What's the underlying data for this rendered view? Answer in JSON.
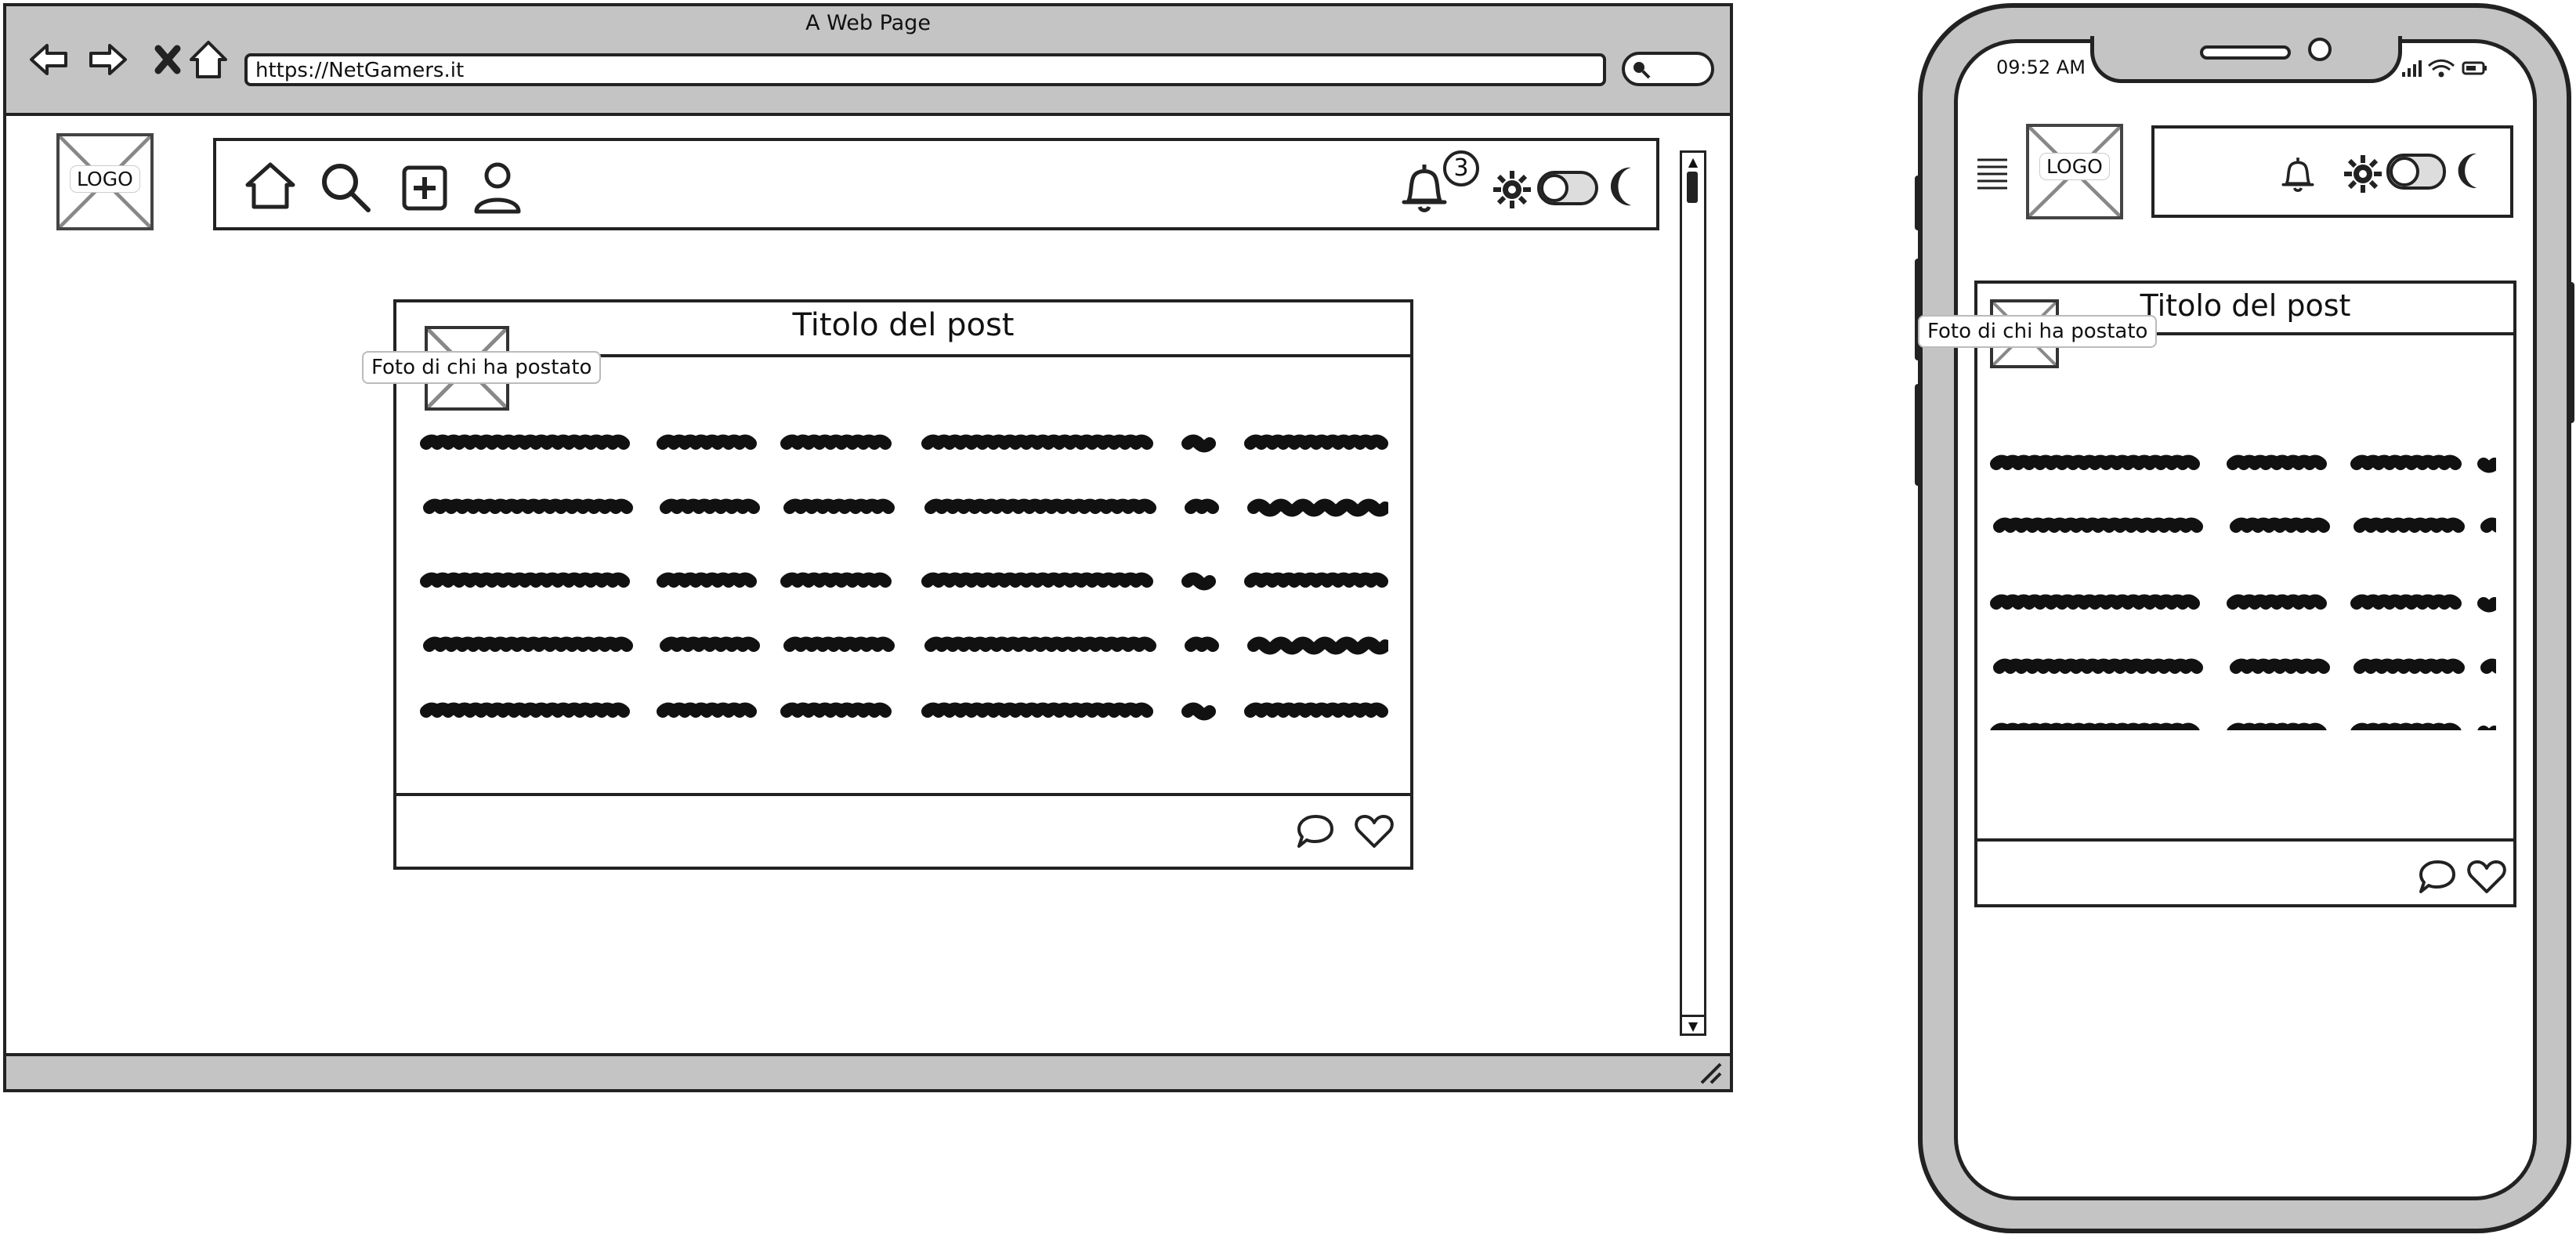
{
  "browser": {
    "window_title": "A Web Page",
    "url": "https://NetGamers.it",
    "nav_icons": [
      "back-arrow-icon",
      "forward-arrow-icon",
      "close-x-icon",
      "home-icon"
    ]
  },
  "desktop": {
    "logo": "LOGO",
    "navbar": {
      "left_icons": [
        "home-icon",
        "search-icon",
        "plus-square-icon",
        "user-icon"
      ],
      "right_icons": [
        "bell-icon",
        "sun-icon",
        "toggle-switch",
        "moon-icon"
      ],
      "notification_count": "3"
    },
    "post": {
      "title": "Titolo del post",
      "author_photo_tooltip": "Foto di chi ha postato",
      "footer_icons": [
        "comment-icon",
        "heart-icon"
      ]
    }
  },
  "mobile": {
    "status_time": "09:52 AM",
    "logo": "LOGO",
    "header_icons": [
      "hamburger-menu-icon",
      "bell-icon",
      "sun-icon",
      "toggle-switch",
      "moon-icon"
    ],
    "post": {
      "title": "Titolo del post",
      "author_photo_tooltip": "Foto di chi ha postato",
      "footer_icons": [
        "comment-icon",
        "heart-icon"
      ]
    }
  },
  "colors": {
    "chrome_gray": "#c4c4c4",
    "ink": "#222222",
    "placeholder_x": "#888888"
  }
}
